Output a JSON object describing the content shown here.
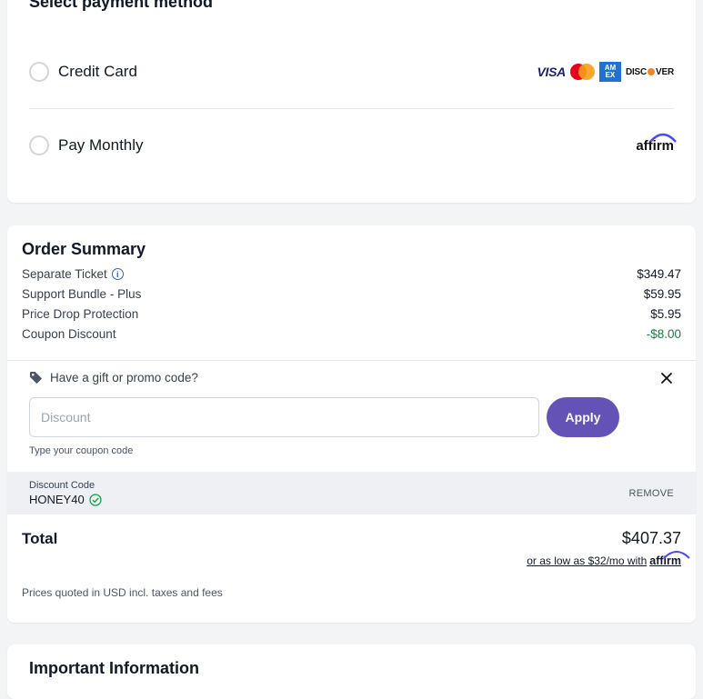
{
  "payment": {
    "title": "Select payment method",
    "options": [
      {
        "label": "Credit Card",
        "logos": [
          "VISA",
          "mastercard",
          "AMEX",
          "DISCOVER"
        ]
      },
      {
        "label": "Pay Monthly",
        "logo": "affirm"
      }
    ]
  },
  "order_summary": {
    "title": "Order Summary",
    "lines": [
      {
        "label": "Separate Ticket",
        "value": "$349.47",
        "icon": "info-icon"
      },
      {
        "label": "Support Bundle - Plus",
        "value": "$59.95"
      },
      {
        "label": "Price Drop Protection",
        "value": "$5.95"
      },
      {
        "label": "Coupon Discount",
        "value": "-$8.00"
      }
    ],
    "promo": {
      "prompt": "Have a gift or promo code?",
      "placeholder": "Discount",
      "apply_label": "Apply",
      "hint": "Type your coupon code"
    },
    "applied_code": {
      "label": "Discount Code",
      "code": "HONEY40",
      "remove_label": "REMOVE"
    },
    "total_label": "Total",
    "total_value": "$407.37",
    "financing_text": "or as low as $32/mo with",
    "financing_brand": "affirm",
    "note": "Prices quoted in USD incl. taxes and fees"
  },
  "important_info": {
    "title": "Important Information"
  },
  "colors": {
    "accent": "#6552b7",
    "discount_green": "#15803d"
  }
}
